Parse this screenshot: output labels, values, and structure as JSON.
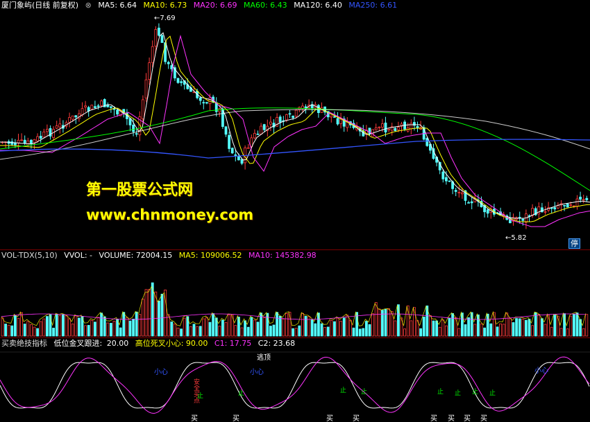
{
  "price_panel": {
    "title": "厦门象屿(日线 前复权)",
    "ma": [
      {
        "label": "MA5: 6.64",
        "color": "#ffffff"
      },
      {
        "label": "MA10: 6.73",
        "color": "#ffff00"
      },
      {
        "label": "MA20: 6.69",
        "color": "#ff33ff"
      },
      {
        "label": "MA60: 6.43",
        "color": "#00ff00"
      },
      {
        "label": "MA120: 6.40",
        "color": "#ffffff"
      },
      {
        "label": "MA250: 6.61",
        "color": "#3355ff"
      }
    ],
    "high_label": "7.69",
    "low_label": "5.82",
    "suspend_badge": "停"
  },
  "watermark": {
    "line1": "第一股票公式网",
    "line2": "www.chnmoney.com"
  },
  "volume_panel": {
    "title": "VOL-TDX(5,10)",
    "vvol": "VVOL: -",
    "volume": "VOLUME: 72004.15",
    "ma5": "MA5: 109006.52",
    "ma10": "MA10: 145382.98"
  },
  "indicator_panel": {
    "title": "买卖绝技指标",
    "low_cross_label": "低位金叉跟进:",
    "low_cross_value": "20.00",
    "high_cross": "高位死叉小心: 90.00",
    "c1": "C1: 17.75",
    "c2": "C2: 23.68",
    "signals": {
      "buy": "买",
      "escape_top": "逃顶",
      "watch": "小心",
      "safe": "安全买点",
      "small": "止"
    }
  },
  "colors": {
    "up": "#ff3b3b",
    "down": "#54ffff",
    "ma5": "#ffffff",
    "ma10": "#ffff00",
    "ma20": "#ff33ff",
    "ma60": "#00ff00",
    "ma250": "#3355ff",
    "border": "#7a0000"
  }
}
